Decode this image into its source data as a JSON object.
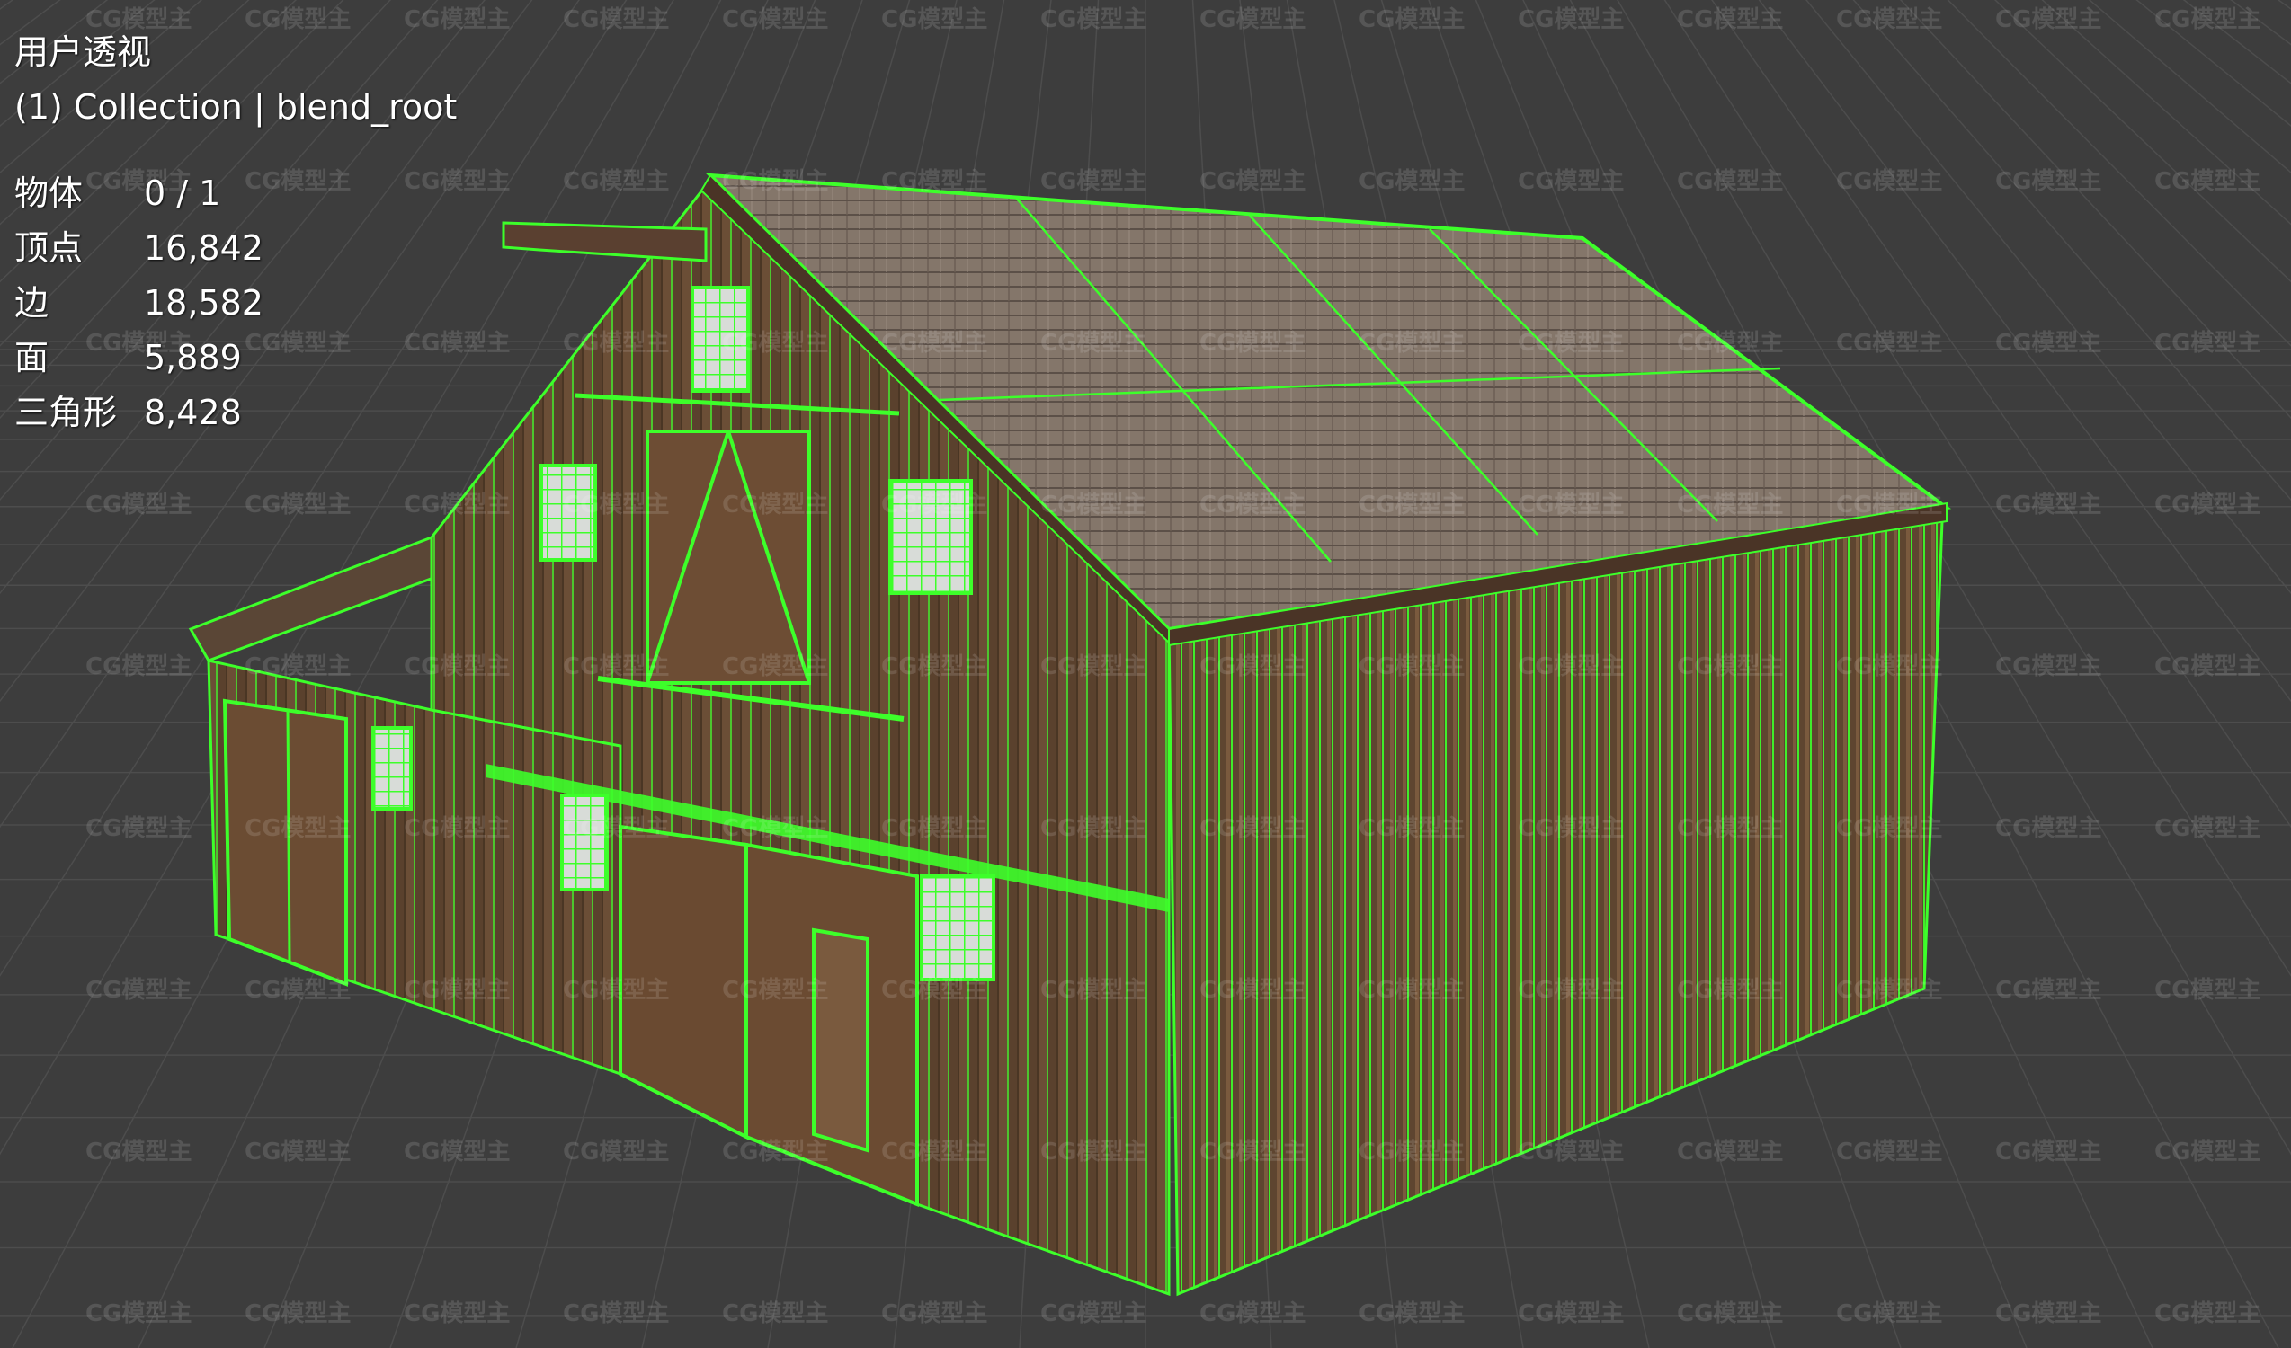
{
  "viewport": {
    "view_name": "用户透视",
    "collection_label": "(1) Collection | blend_root",
    "stats": [
      {
        "label": "物体",
        "value": "0 / 1"
      },
      {
        "label": "顶点",
        "value": "16,842"
      },
      {
        "label": "边",
        "value": "18,582"
      },
      {
        "label": "面",
        "value": "5,889"
      },
      {
        "label": "三角形",
        "value": "8,428"
      }
    ]
  },
  "watermark": "CG模型主",
  "colors": {
    "background": "#3d3d3d",
    "grid": "#4a4a4a",
    "wireframe": "#3dff2a",
    "wood": "#6a4d35",
    "roof": "#8a7a6a"
  }
}
